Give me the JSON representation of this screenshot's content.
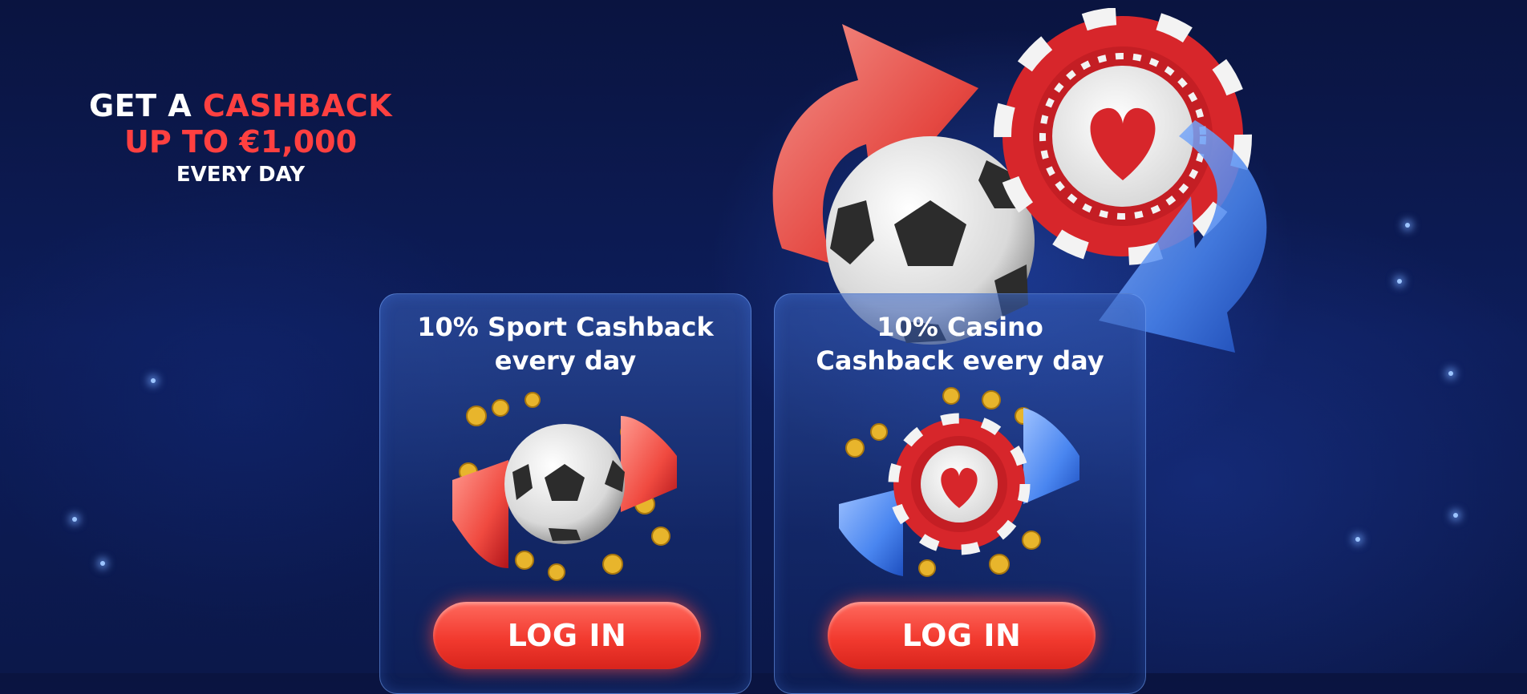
{
  "headline": {
    "line1_prefix": "GET A ",
    "line1_highlight": "CASHBACK",
    "line2": "UP TO €1,000",
    "line3": "EVERY DAY"
  },
  "cards": [
    {
      "title_line1": "10% Sport Cashback",
      "title_line2": "every day",
      "button_label": "LOG IN",
      "art_icon": "soccer-ball-coins-icon"
    },
    {
      "title_line1": "10% Casino",
      "title_line2": "Cashback every day",
      "button_label": "LOG IN",
      "art_icon": "casino-chip-coins-icon"
    }
  ],
  "colors": {
    "accent_red": "#ff4040",
    "background": "#0d1d5a",
    "button": "#f23a2f"
  },
  "hero_icon": "soccer-ball-casino-chip-arrows-icon"
}
